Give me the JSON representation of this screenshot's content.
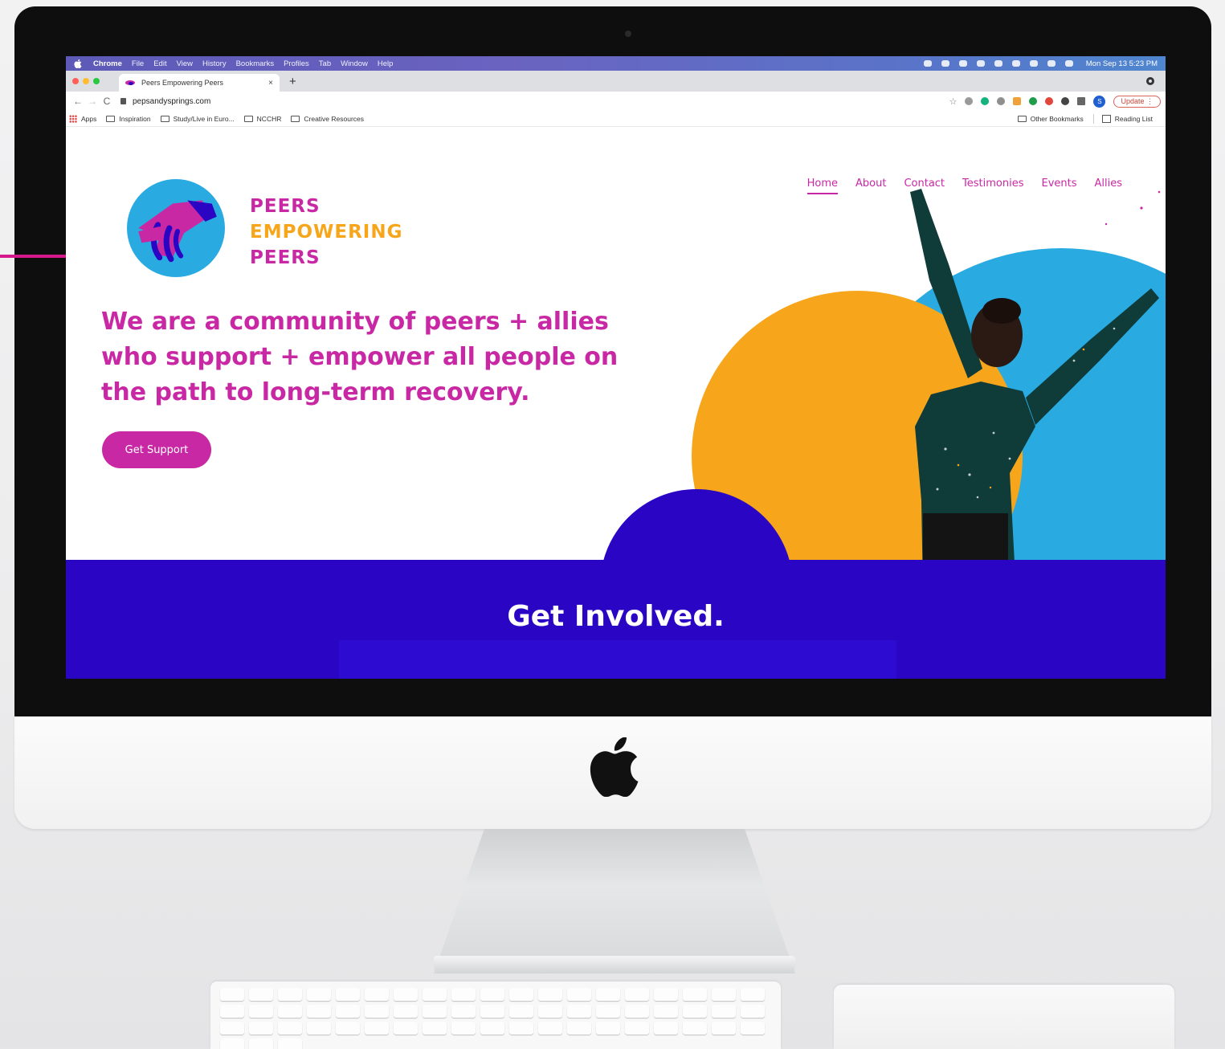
{
  "os_menubar": {
    "app": "Chrome",
    "menus": [
      "File",
      "Edit",
      "View",
      "History",
      "Bookmarks",
      "Profiles",
      "Tab",
      "Window",
      "Help"
    ],
    "clock": "Mon Sep 13  5:23 PM"
  },
  "browser": {
    "tab_title": "Peers Empowering Peers",
    "tab_close": "×",
    "new_tab": "+",
    "url": "pepsandysprings.com",
    "profile_initial": "S",
    "update_label": "Update",
    "bookmarks": [
      "Apps",
      "Inspiration",
      "Study/Live in Euro...",
      "NCCHR",
      "Creative Resources"
    ],
    "other_bookmarks": "Other Bookmarks",
    "reading_list": "Reading List"
  },
  "site": {
    "brand": {
      "line1": "PEERS",
      "line2": "EMPOWERING",
      "line3": "PEERS"
    },
    "nav": [
      "Home",
      "About",
      "Contact",
      "Testimonies",
      "Events",
      "Allies"
    ],
    "active_nav": "Home",
    "headline": "We are a community of peers + allies who support + empower all people on the path to long-term recovery.",
    "cta_label": "Get Support",
    "section_title": "Get Involved."
  },
  "colors": {
    "magenta": "#c928a4",
    "orange": "#f7a61c",
    "sky": "#29abe2",
    "indigo": "#2a06c4"
  },
  "icons": [
    "apple-logo-icon",
    "lock-icon",
    "star-icon",
    "folder-icon",
    "reading-list-icon",
    "handshake-icon"
  ]
}
